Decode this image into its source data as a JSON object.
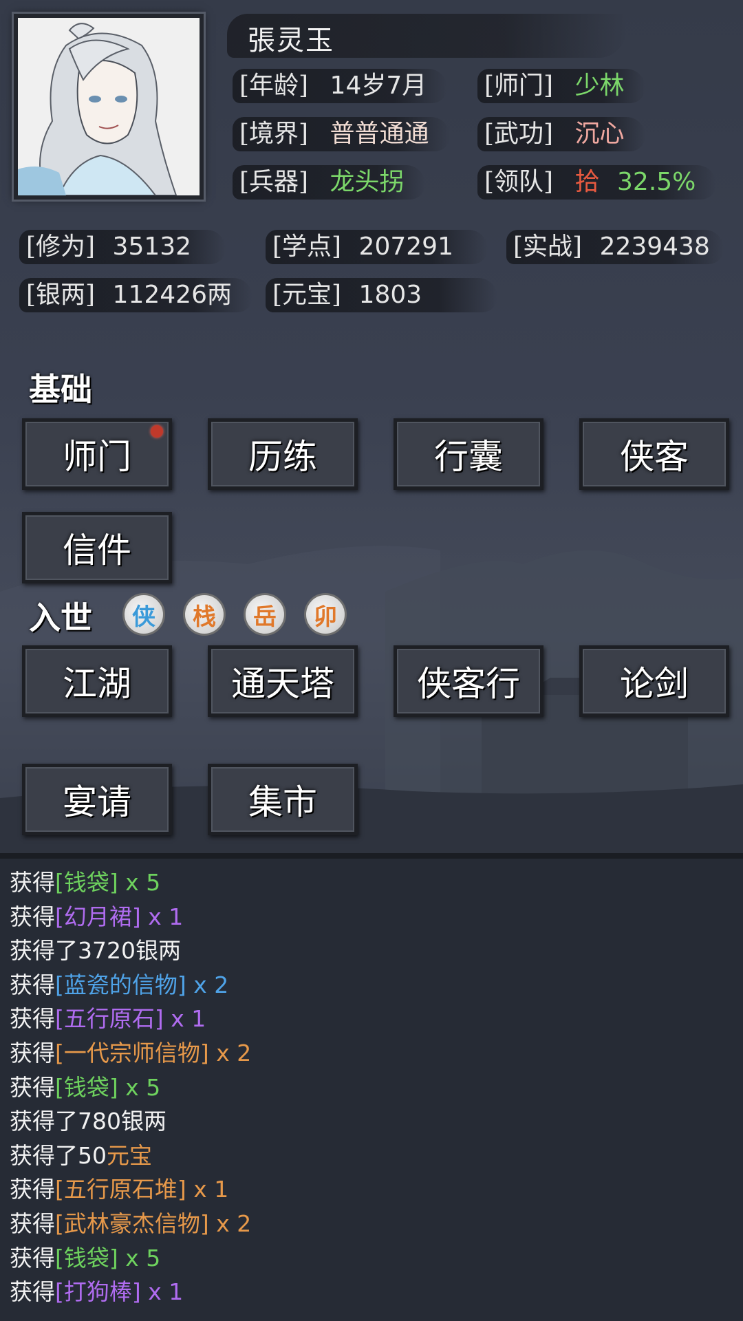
{
  "character": {
    "name": "張灵玉",
    "stats_top": {
      "age": {
        "label": "[年龄]",
        "value": "14岁7月"
      },
      "sect": {
        "label": "[师门]",
        "value": "少林",
        "color": "#7cd86a"
      },
      "realm": {
        "label": "[境界]",
        "value": "普普通通",
        "color": "#f2ddd4"
      },
      "martial": {
        "label": "[武功]",
        "value": "沉心",
        "color": "#f0a8a0"
      },
      "weapon": {
        "label": "[兵器]",
        "value": "龙头拐",
        "color": "#7cd86a"
      },
      "team": {
        "label": "[领队]",
        "value_rank": "拾",
        "value_pct": "32.5%",
        "rank_color": "#e85a40",
        "pct_color": "#7cd86a"
      }
    },
    "stats_bottom": {
      "cultivation": {
        "label": "[修为]",
        "value": "35132"
      },
      "study_points": {
        "label": "[学点]",
        "value": "207291"
      },
      "combat": {
        "label": "[实战]",
        "value": "2239438"
      },
      "silver": {
        "label": "[银两]",
        "value": "112426两"
      },
      "yuanbao": {
        "label": "[元宝]",
        "value": "1803"
      }
    }
  },
  "sections": {
    "basic": {
      "title": "基础",
      "buttons": [
        "师门",
        "历练",
        "行囊",
        "侠客",
        "信件"
      ]
    },
    "world": {
      "title": "入世",
      "badges": [
        {
          "text": "侠",
          "color": "#3a9ad9"
        },
        {
          "text": "栈",
          "color": "#e0782a"
        },
        {
          "text": "岳",
          "color": "#e0782a"
        },
        {
          "text": "卯",
          "color": "#e0782a"
        }
      ],
      "buttons": [
        "江湖",
        "通天塔",
        "侠客行",
        "论剑",
        "宴请",
        "集市"
      ]
    }
  },
  "log": [
    [
      {
        "t": "获得",
        "c": "w"
      },
      {
        "t": "[钱袋]",
        "c": "g"
      },
      {
        "t": " x 5",
        "c": "g"
      }
    ],
    [
      {
        "t": "获得",
        "c": "w"
      },
      {
        "t": "[幻月裙]",
        "c": "p"
      },
      {
        "t": " x 1",
        "c": "p"
      }
    ],
    [
      {
        "t": "获得了3720银两",
        "c": "w"
      }
    ],
    [
      {
        "t": "获得",
        "c": "w"
      },
      {
        "t": "[蓝瓷的信物]",
        "c": "b"
      },
      {
        "t": " x 2",
        "c": "b"
      }
    ],
    [
      {
        "t": "获得",
        "c": "w"
      },
      {
        "t": "[五行原石]",
        "c": "p"
      },
      {
        "t": " x 1",
        "c": "p"
      }
    ],
    [
      {
        "t": "获得",
        "c": "w"
      },
      {
        "t": "[一代宗师信物]",
        "c": "o"
      },
      {
        "t": " x 2",
        "c": "o"
      }
    ],
    [
      {
        "t": "获得",
        "c": "w"
      },
      {
        "t": "[钱袋]",
        "c": "g"
      },
      {
        "t": " x 5",
        "c": "g"
      }
    ],
    [
      {
        "t": "获得了780银两",
        "c": "w"
      }
    ],
    [
      {
        "t": "获得了50",
        "c": "w"
      },
      {
        "t": "元宝",
        "c": "o"
      }
    ],
    [
      {
        "t": "获得",
        "c": "w"
      },
      {
        "t": "[五行原石堆]",
        "c": "o"
      },
      {
        "t": " x 1",
        "c": "o"
      }
    ],
    [
      {
        "t": "获得",
        "c": "w"
      },
      {
        "t": "[武林豪杰信物]",
        "c": "o"
      },
      {
        "t": " x 2",
        "c": "o"
      }
    ],
    [
      {
        "t": "获得",
        "c": "w"
      },
      {
        "t": "[钱袋]",
        "c": "g"
      },
      {
        "t": " x 5",
        "c": "g"
      }
    ],
    [
      {
        "t": "获得",
        "c": "w"
      },
      {
        "t": "[打狗棒]",
        "c": "p"
      },
      {
        "t": " x 1",
        "c": "p"
      }
    ]
  ]
}
